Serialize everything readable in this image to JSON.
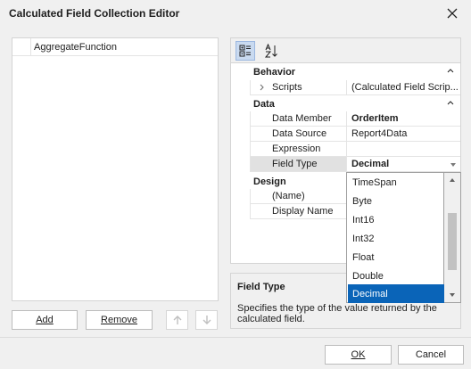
{
  "window": {
    "title": "Calculated Field Collection Editor"
  },
  "collection": {
    "items": [
      "AggregateFunction"
    ]
  },
  "buttons": {
    "add": "Add",
    "remove": "Remove",
    "ok": "OK",
    "cancel": "Cancel"
  },
  "toolbar": {
    "categorized_icon": "categorized-icon",
    "alphabetical_icon": "sort-az-icon"
  },
  "grid": {
    "categories": {
      "behavior": "Behavior",
      "data": "Data",
      "design": "Design"
    },
    "behavior": {
      "scripts": {
        "name": "Scripts",
        "value": "(Calculated Field Scrip..."
      }
    },
    "data": {
      "data_member": {
        "name": "Data Member",
        "value": "OrderItem"
      },
      "data_source": {
        "name": "Data Source",
        "value": "Report4Data"
      },
      "expression": {
        "name": "Expression",
        "value": ""
      },
      "field_type": {
        "name": "Field Type",
        "value": "Decimal"
      }
    },
    "design": {
      "name": {
        "name": "(Name)",
        "value": ""
      },
      "display_name": {
        "name": "Display Name",
        "value": ""
      }
    }
  },
  "field_type_dropdown": {
    "options": [
      "TimeSpan",
      "Byte",
      "Int16",
      "Int32",
      "Float",
      "Double",
      "Decimal"
    ],
    "selected": "Decimal"
  },
  "description": {
    "title": "Field Type",
    "text": "Specifies the type of the value returned by the calculated field."
  },
  "colors": {
    "selection": "#0a64b8",
    "window_bg": "#f0f0f0"
  }
}
